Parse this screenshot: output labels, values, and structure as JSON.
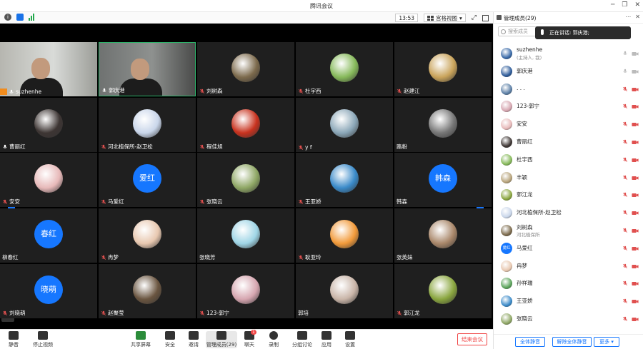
{
  "window": {
    "title": "腾讯会议"
  },
  "toolbar": {
    "time": "13:53",
    "view_label": "宫格视图"
  },
  "panel": {
    "title": "管理成员(29)",
    "search_placeholder": "搜索成员",
    "speaking": "正在讲话: 郭庆港;",
    "members": [
      {
        "name": "suzhenhe",
        "sub": "(主持人, 我)",
        "muted": false,
        "av": "#3a6aa8"
      },
      {
        "name": "郭庆港",
        "sub": "",
        "muted": false,
        "av": "#2d5b9a"
      },
      {
        "name": ". . .",
        "sub": "",
        "muted": true,
        "av": "#5b7fa6"
      },
      {
        "name": "123-郭宁",
        "sub": "",
        "muted": true,
        "av": "#d6a6b0"
      },
      {
        "name": "安安",
        "sub": "",
        "muted": true,
        "av": "#e7b9b9"
      },
      {
        "name": "曹丽红",
        "sub": "",
        "muted": true,
        "av": "#3d3533"
      },
      {
        "name": "杜宇西",
        "sub": "",
        "muted": true,
        "av": "#86b95a"
      },
      {
        "name": "丰颖",
        "sub": "",
        "muted": true,
        "av": "#b8a47b"
      },
      {
        "name": "郭江龙",
        "sub": "",
        "muted": true,
        "av": "#8aa63f"
      },
      {
        "name": "河北植保所-赵卫松",
        "sub": "",
        "muted": true,
        "av": "#c9d6ea"
      },
      {
        "name": "刘树森",
        "sub": "河北植保所",
        "muted": true,
        "av": "#7c6a4c"
      },
      {
        "name": "马爱红",
        "sub": "",
        "muted": true,
        "av": "",
        "txt": "爱红"
      },
      {
        "name": "冉梦",
        "sub": "",
        "muted": true,
        "av": "#e8c8b0"
      },
      {
        "name": "孙祥瑞",
        "sub": "",
        "muted": true,
        "av": "#5aa35a"
      },
      {
        "name": "王亚娇",
        "sub": "",
        "muted": true,
        "av": "#3a8ac9"
      },
      {
        "name": "张晓云",
        "sub": "",
        "muted": true,
        "av": "#8fa765"
      }
    ],
    "mute_all": "全体静音",
    "unmute_all": "解除全体静音",
    "more": "更多"
  },
  "tiles": [
    {
      "name": "suzhenhe",
      "type": "video",
      "muted": false,
      "host": true
    },
    {
      "name": "郭庆港",
      "type": "video",
      "muted": false,
      "active": true
    },
    {
      "name": "刘树森",
      "type": "img",
      "color": "#7c6a4c",
      "muted": true
    },
    {
      "name": "杜宇西",
      "type": "img",
      "color": "#86b95a",
      "muted": true
    },
    {
      "name": "赵建江",
      "type": "img",
      "color": "#c9a35a",
      "muted": true
    },
    {
      "name": "曹丽红",
      "type": "img",
      "color": "#3d3533",
      "muted": false
    },
    {
      "name": "河北植保所-赵卫松",
      "type": "img",
      "color": "#c9d6ea",
      "muted": true
    },
    {
      "name": "程佳旭",
      "type": "img",
      "color": "#c8321e",
      "muted": true
    },
    {
      "name": "y f",
      "type": "img",
      "color": "#8ba7b8",
      "muted": true
    },
    {
      "name": "路粉",
      "type": "img",
      "color": "#777777",
      "muted": false
    },
    {
      "name": "安安",
      "type": "img",
      "color": "#e7b9b9",
      "muted": true
    },
    {
      "name": "马爱红",
      "type": "txt",
      "txt": "爱红",
      "muted": true
    },
    {
      "name": "张晓云",
      "type": "img",
      "color": "#8fa765",
      "muted": true
    },
    {
      "name": "王亚娇",
      "type": "img",
      "color": "#3a8ac9",
      "muted": true
    },
    {
      "name": "韩森",
      "type": "txt",
      "txt": "韩森",
      "muted": false
    },
    {
      "name": "柳春红",
      "type": "txt",
      "txt": "春红",
      "muted": false
    },
    {
      "name": "冉梦",
      "type": "img",
      "color": "#e8c8b0",
      "muted": true
    },
    {
      "name": "张晓芳",
      "type": "img",
      "color": "#9fd5e6",
      "muted": false
    },
    {
      "name": "耿亚玲",
      "type": "img",
      "color": "#f29a3a",
      "muted": true
    },
    {
      "name": "张英妹",
      "type": "img",
      "color": "#a9876a",
      "muted": false
    },
    {
      "name": "刘晓萌",
      "type": "txt",
      "txt": "晓萌",
      "muted": true
    },
    {
      "name": "赵聚莹",
      "type": "img",
      "color": "#6a5540",
      "muted": true
    },
    {
      "name": "123-郭宁",
      "type": "img",
      "color": "#d6a6b0",
      "muted": true
    },
    {
      "name": "郭培",
      "type": "img",
      "color": "#c9b5a8",
      "muted": false
    },
    {
      "name": "郭江龙",
      "type": "img",
      "color": "#8aa63f",
      "muted": true
    }
  ],
  "bottombar": {
    "mute": "静音",
    "stop_video": "停止视频",
    "share": "共享屏幕",
    "security": "安全",
    "invite": "邀请",
    "manage": "管理成员(29)",
    "chat": "聊天",
    "chat_badge": "1",
    "record": "录制",
    "breakout": "分组讨论",
    "apps": "应用",
    "settings": "设置",
    "end": "结束会议"
  }
}
